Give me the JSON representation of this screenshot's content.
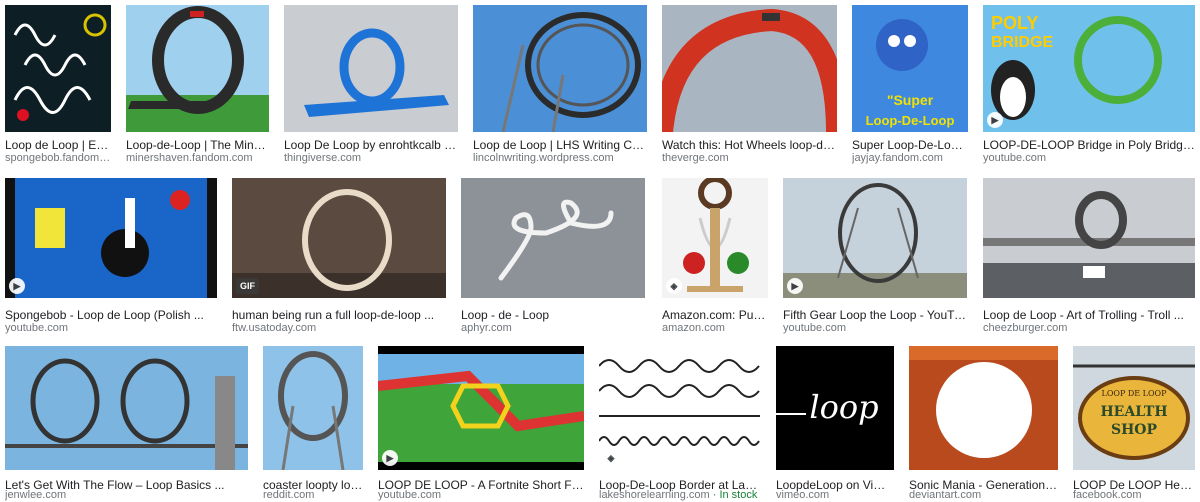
{
  "results": [
    {
      "title": "Loop de Loop | Encyclop...",
      "source": "spongebob.fandom.com",
      "badge": ""
    },
    {
      "title": "Loop-de-Loop | The Miner's Haven...",
      "source": "minershaven.fandom.com",
      "badge": ""
    },
    {
      "title": "Loop De Loop by enrohtkcalb - Thingiverse",
      "source": "thingiverse.com",
      "badge": ""
    },
    {
      "title": "Loop de Loop | LHS Writing Center",
      "source": "lincolnwriting.wordpress.com",
      "badge": ""
    },
    {
      "title": "Watch this: Hot Wheels loop-de-loop ...",
      "source": "theverge.com",
      "badge": ""
    },
    {
      "title": "Super Loop-De-Loop | Jay ...",
      "source": "jayjay.fandom.com",
      "badge": "",
      "image_text": "\"Super Loop-De-Loop\""
    },
    {
      "title": "LOOP-DE-LOOP Bridge in Poly Bridge ...",
      "source": "youtube.com",
      "badge": "play",
      "image_text": "POLY BRIDGE"
    },
    {
      "title": "Spongebob - Loop de Loop (Polish ...",
      "source": "youtube.com",
      "badge": "play"
    },
    {
      "title": "human being run a full loop-de-loop ...",
      "source": "ftw.usatoday.com",
      "badge": "GIF"
    },
    {
      "title": "Loop - de - Loop",
      "source": "aphyr.com",
      "badge": ""
    },
    {
      "title": "Amazon.com: Puzzle M...",
      "source": "amazon.com",
      "badge": "tag"
    },
    {
      "title": "Fifth Gear Loop the Loop - YouTube",
      "source": "youtube.com",
      "badge": "play"
    },
    {
      "title": "Loop de Loop - Art of Trolling - Troll ...",
      "source": "cheezburger.com",
      "badge": ""
    },
    {
      "title": "Let's Get With The Flow – Loop Basics ...",
      "source": "jenwlee.com",
      "badge": ""
    },
    {
      "title": "coaster loopty loop edi...",
      "source": "reddit.com",
      "badge": ""
    },
    {
      "title": "LOOP DE LOOP - A Fortnite Short Film ...",
      "source": "youtube.com",
      "badge": "play"
    },
    {
      "title": "Loop-De-Loop Border at Lakeshore Lea...",
      "source": "lakeshorelearning.com",
      "stock": " · In stock",
      "badge": "tag"
    },
    {
      "title": "LoopdeLoop on Vimeo",
      "source": "vimeo.com",
      "badge": "",
      "image_text": "loop"
    },
    {
      "title": "Sonic Mania - Generations' style Lo...",
      "source": "deviantart.com",
      "badge": ""
    },
    {
      "title": "LOOP De LOOP Healthstore...",
      "source": "facebook.com",
      "badge": "",
      "image_text": "LOOP DE LOOP HEALTH SHOP"
    }
  ]
}
